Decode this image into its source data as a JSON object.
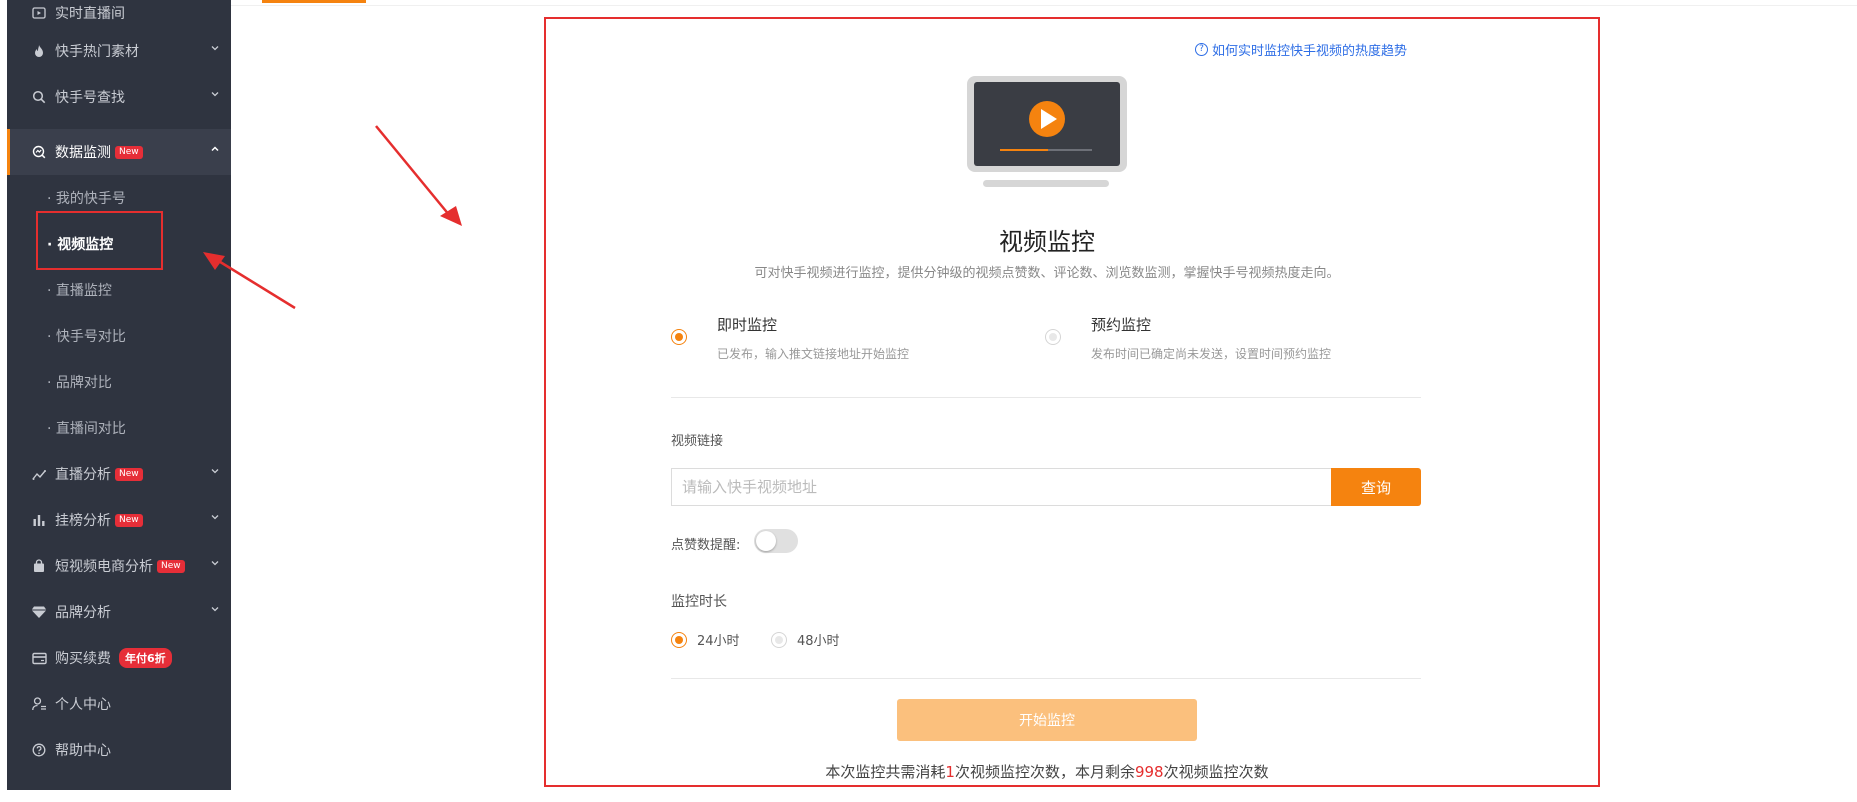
{
  "sidebar": {
    "items": [
      {
        "label": "实时直播间",
        "icon": "live-room-icon"
      },
      {
        "label": "快手热门素材",
        "icon": "fire-icon"
      },
      {
        "label": "快手号查找",
        "icon": "search-icon"
      },
      {
        "label": "数据监测",
        "icon": "monitor-icon",
        "badge": "New"
      },
      {
        "label": "直播分析",
        "icon": "trend-icon",
        "badge": "New"
      },
      {
        "label": "挂榜分析",
        "icon": "bar-icon",
        "badge": "New"
      },
      {
        "label": "短视频电商分析",
        "icon": "shopping-bag-icon",
        "badge": "New"
      },
      {
        "label": "品牌分析",
        "icon": "diamond-icon"
      },
      {
        "label": "购买续费",
        "icon": "card-icon",
        "badge": "年付6折"
      },
      {
        "label": "个人中心",
        "icon": "user-icon"
      },
      {
        "label": "帮助中心",
        "icon": "help-icon"
      }
    ],
    "subitems": [
      {
        "label": "· 我的快手号"
      },
      {
        "label": "· 视频监控",
        "selected": true
      },
      {
        "label": "· 直播监控"
      },
      {
        "label": "· 快手号对比"
      },
      {
        "label": "· 品牌对比"
      },
      {
        "label": "· 直播间对比"
      }
    ]
  },
  "main": {
    "help_link": "如何实时监控快手视频的热度趋势",
    "help_icon": "question-circle-icon",
    "title": "视频监控",
    "subtitle": "可对快手视频进行监控，提供分钟级的视频点赞数、评论数、浏览数监测，掌握快手号视频热度走向。",
    "modes": [
      {
        "title": "即时监控",
        "desc": "已发布，输入推文链接地址开始监控",
        "checked": true
      },
      {
        "title": "预约监控",
        "desc": "发布时间已确定尚未发送，设置时间预约监控",
        "checked": false
      }
    ],
    "link_label": "视频链接",
    "link_placeholder": "请输入快手视频地址",
    "query_label": "查询",
    "like_alert_label": "点赞数提醒:",
    "like_alert_on": false,
    "duration_label": "监控时长",
    "durations": [
      {
        "label": "24小时",
        "checked": true
      },
      {
        "label": "48小时",
        "checked": false
      }
    ],
    "start_label": "开始监控",
    "note_prefix": "本次监控共需消耗",
    "note_cost": "1",
    "note_mid": "次视频监控次数，本月剩余",
    "note_remaining": "998",
    "note_suffix": "次视频监控次数"
  },
  "colors": {
    "accent": "#f5830f",
    "sidebar_bg": "#2f3440",
    "badge_red": "#e62e38",
    "annotation_red": "#e52e2e",
    "link_blue": "#2e6ee6"
  }
}
